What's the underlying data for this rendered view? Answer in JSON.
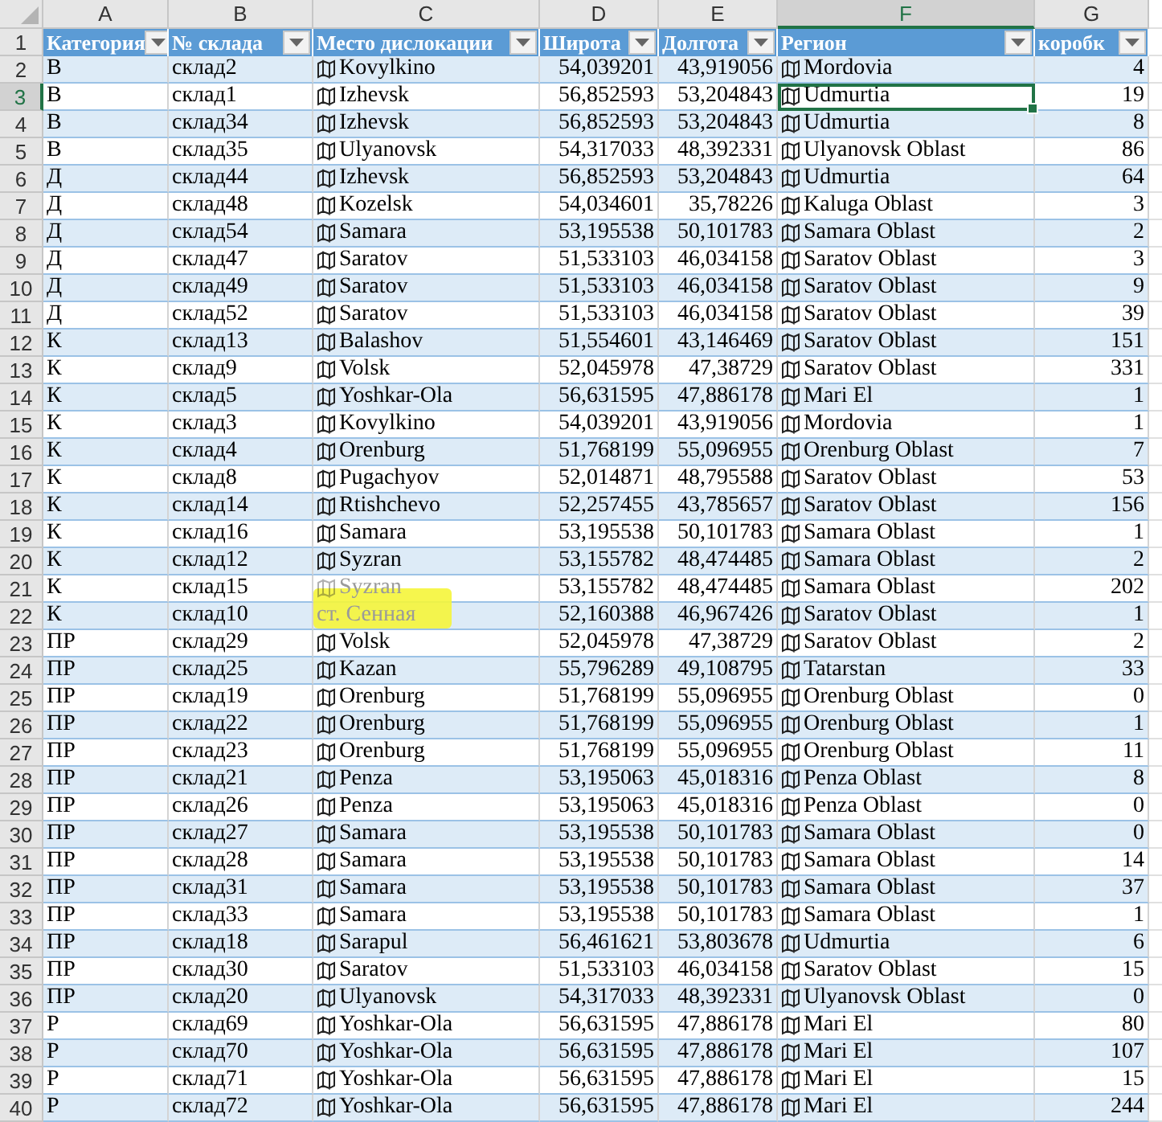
{
  "columns": [
    {
      "letter": "A",
      "selected": false
    },
    {
      "letter": "B",
      "selected": false
    },
    {
      "letter": "C",
      "selected": false
    },
    {
      "letter": "D",
      "selected": false
    },
    {
      "letter": "E",
      "selected": false
    },
    {
      "letter": "F",
      "selected": true
    },
    {
      "letter": "G",
      "selected": false
    }
  ],
  "header": {
    "num": "1",
    "cells": [
      "Категория",
      "№ склада",
      "Место дислокации",
      "Широта",
      "Долгота",
      "Регион",
      "коробк"
    ]
  },
  "rows": [
    {
      "num": "2",
      "selected": false,
      "category": "В",
      "warehouse": "склад2",
      "place": "Kovylkino",
      "place_icon": true,
      "place_faded": false,
      "highlighted": false,
      "lat": "54,039201",
      "lon": "43,919056",
      "region": "Mordovia",
      "boxes": "4"
    },
    {
      "num": "3",
      "selected": true,
      "category": "В",
      "warehouse": "склад1",
      "place": "Izhevsk",
      "place_icon": true,
      "place_faded": false,
      "highlighted": false,
      "lat": "56,852593",
      "lon": "53,204843",
      "region": "Udmurtia",
      "boxes": "19"
    },
    {
      "num": "4",
      "selected": false,
      "category": "В",
      "warehouse": "склад34",
      "place": "Izhevsk",
      "place_icon": true,
      "place_faded": false,
      "highlighted": false,
      "lat": "56,852593",
      "lon": "53,204843",
      "region": "Udmurtia",
      "boxes": "8"
    },
    {
      "num": "5",
      "selected": false,
      "category": "В",
      "warehouse": "склад35",
      "place": "Ulyanovsk",
      "place_icon": true,
      "place_faded": false,
      "highlighted": false,
      "lat": "54,317033",
      "lon": "48,392331",
      "region": "Ulyanovsk Oblast",
      "boxes": "86"
    },
    {
      "num": "6",
      "selected": false,
      "category": "Д",
      "warehouse": "склад44",
      "place": "Izhevsk",
      "place_icon": true,
      "place_faded": false,
      "highlighted": false,
      "lat": "56,852593",
      "lon": "53,204843",
      "region": "Udmurtia",
      "boxes": "64"
    },
    {
      "num": "7",
      "selected": false,
      "category": "Д",
      "warehouse": "склад48",
      "place": "Kozelsk",
      "place_icon": true,
      "place_faded": false,
      "highlighted": false,
      "lat": "54,034601",
      "lon": "35,78226",
      "region": "Kaluga Oblast",
      "boxes": "3"
    },
    {
      "num": "8",
      "selected": false,
      "category": "Д",
      "warehouse": "склад54",
      "place": "Samara",
      "place_icon": true,
      "place_faded": false,
      "highlighted": false,
      "lat": "53,195538",
      "lon": "50,101783",
      "region": "Samara Oblast",
      "boxes": "2"
    },
    {
      "num": "9",
      "selected": false,
      "category": "Д",
      "warehouse": "склад47",
      "place": "Saratov",
      "place_icon": true,
      "place_faded": false,
      "highlighted": false,
      "lat": "51,533103",
      "lon": "46,034158",
      "region": "Saratov Oblast",
      "boxes": "3"
    },
    {
      "num": "10",
      "selected": false,
      "category": "Д",
      "warehouse": "склад49",
      "place": "Saratov",
      "place_icon": true,
      "place_faded": false,
      "highlighted": false,
      "lat": "51,533103",
      "lon": "46,034158",
      "region": "Saratov Oblast",
      "boxes": "9"
    },
    {
      "num": "11",
      "selected": false,
      "category": "Д",
      "warehouse": "склад52",
      "place": "Saratov",
      "place_icon": true,
      "place_faded": false,
      "highlighted": false,
      "lat": "51,533103",
      "lon": "46,034158",
      "region": "Saratov Oblast",
      "boxes": "39"
    },
    {
      "num": "12",
      "selected": false,
      "category": "К",
      "warehouse": "склад13",
      "place": "Balashov",
      "place_icon": true,
      "place_faded": false,
      "highlighted": false,
      "lat": "51,554601",
      "lon": "43,146469",
      "region": "Saratov Oblast",
      "boxes": "151"
    },
    {
      "num": "13",
      "selected": false,
      "category": "К",
      "warehouse": "склад9",
      "place": "Volsk",
      "place_icon": true,
      "place_faded": false,
      "highlighted": false,
      "lat": "52,045978",
      "lon": "47,38729",
      "region": "Saratov Oblast",
      "boxes": "331"
    },
    {
      "num": "14",
      "selected": false,
      "category": "К",
      "warehouse": "склад5",
      "place": "Yoshkar-Ola",
      "place_icon": true,
      "place_faded": false,
      "highlighted": false,
      "lat": "56,631595",
      "lon": "47,886178",
      "region": "Mari El",
      "boxes": "1"
    },
    {
      "num": "15",
      "selected": false,
      "category": "К",
      "warehouse": "склад3",
      "place": "Kovylkino",
      "place_icon": true,
      "place_faded": false,
      "highlighted": false,
      "lat": "54,039201",
      "lon": "43,919056",
      "region": "Mordovia",
      "boxes": "1"
    },
    {
      "num": "16",
      "selected": false,
      "category": "К",
      "warehouse": "склад4",
      "place": "Orenburg",
      "place_icon": true,
      "place_faded": false,
      "highlighted": false,
      "lat": "51,768199",
      "lon": "55,096955",
      "region": "Orenburg Oblast",
      "boxes": "7"
    },
    {
      "num": "17",
      "selected": false,
      "category": "К",
      "warehouse": "склад8",
      "place": "Pugachyov",
      "place_icon": true,
      "place_faded": false,
      "highlighted": false,
      "lat": "52,014871",
      "lon": "48,795588",
      "region": "Saratov Oblast",
      "boxes": "53"
    },
    {
      "num": "18",
      "selected": false,
      "category": "К",
      "warehouse": "склад14",
      "place": "Rtishchevo",
      "place_icon": true,
      "place_faded": false,
      "highlighted": false,
      "lat": "52,257455",
      "lon": "43,785657",
      "region": "Saratov Oblast",
      "boxes": "156"
    },
    {
      "num": "19",
      "selected": false,
      "category": "К",
      "warehouse": "склад16",
      "place": "Samara",
      "place_icon": true,
      "place_faded": false,
      "highlighted": false,
      "lat": "53,195538",
      "lon": "50,101783",
      "region": "Samara Oblast",
      "boxes": "1"
    },
    {
      "num": "20",
      "selected": false,
      "category": "К",
      "warehouse": "склад12",
      "place": "Syzran",
      "place_icon": true,
      "place_faded": false,
      "highlighted": false,
      "lat": "53,155782",
      "lon": "48,474485",
      "region": "Samara Oblast",
      "boxes": "2"
    },
    {
      "num": "21",
      "selected": false,
      "category": "К",
      "warehouse": "склад15",
      "place": "Syzran",
      "place_icon": true,
      "place_faded": true,
      "highlighted": false,
      "lat": "53,155782",
      "lon": "48,474485",
      "region": "Samara Oblast",
      "boxes": "202"
    },
    {
      "num": "22",
      "selected": false,
      "category": "К",
      "warehouse": "склад10",
      "place": "ст. Сенная",
      "place_icon": false,
      "place_faded": true,
      "highlighted": true,
      "lat": "52,160388",
      "lon": "46,967426",
      "region": "Saratov Oblast",
      "boxes": "1"
    },
    {
      "num": "23",
      "selected": false,
      "category": "ПР",
      "warehouse": "склад29",
      "place": "Volsk",
      "place_icon": true,
      "place_faded": false,
      "highlighted": false,
      "lat": "52,045978",
      "lon": "47,38729",
      "region": "Saratov Oblast",
      "boxes": "2"
    },
    {
      "num": "24",
      "selected": false,
      "category": "ПР",
      "warehouse": "склад25",
      "place": "Kazan",
      "place_icon": true,
      "place_faded": false,
      "highlighted": false,
      "lat": "55,796289",
      "lon": "49,108795",
      "region": "Tatarstan",
      "boxes": "33"
    },
    {
      "num": "25",
      "selected": false,
      "category": "ПР",
      "warehouse": "склад19",
      "place": "Orenburg",
      "place_icon": true,
      "place_faded": false,
      "highlighted": false,
      "lat": "51,768199",
      "lon": "55,096955",
      "region": "Orenburg Oblast",
      "boxes": "0"
    },
    {
      "num": "26",
      "selected": false,
      "category": "ПР",
      "warehouse": "склад22",
      "place": "Orenburg",
      "place_icon": true,
      "place_faded": false,
      "highlighted": false,
      "lat": "51,768199",
      "lon": "55,096955",
      "region": "Orenburg Oblast",
      "boxes": "1"
    },
    {
      "num": "27",
      "selected": false,
      "category": "ПР",
      "warehouse": "склад23",
      "place": "Orenburg",
      "place_icon": true,
      "place_faded": false,
      "highlighted": false,
      "lat": "51,768199",
      "lon": "55,096955",
      "region": "Orenburg Oblast",
      "boxes": "11"
    },
    {
      "num": "28",
      "selected": false,
      "category": "ПР",
      "warehouse": "склад21",
      "place": "Penza",
      "place_icon": true,
      "place_faded": false,
      "highlighted": false,
      "lat": "53,195063",
      "lon": "45,018316",
      "region": "Penza Oblast",
      "boxes": "8"
    },
    {
      "num": "29",
      "selected": false,
      "category": "ПР",
      "warehouse": "склад26",
      "place": "Penza",
      "place_icon": true,
      "place_faded": false,
      "highlighted": false,
      "lat": "53,195063",
      "lon": "45,018316",
      "region": "Penza Oblast",
      "boxes": "0"
    },
    {
      "num": "30",
      "selected": false,
      "category": "ПР",
      "warehouse": "склад27",
      "place": "Samara",
      "place_icon": true,
      "place_faded": false,
      "highlighted": false,
      "lat": "53,195538",
      "lon": "50,101783",
      "region": "Samara Oblast",
      "boxes": "0"
    },
    {
      "num": "31",
      "selected": false,
      "category": "ПР",
      "warehouse": "склад28",
      "place": "Samara",
      "place_icon": true,
      "place_faded": false,
      "highlighted": false,
      "lat": "53,195538",
      "lon": "50,101783",
      "region": "Samara Oblast",
      "boxes": "14"
    },
    {
      "num": "32",
      "selected": false,
      "category": "ПР",
      "warehouse": "склад31",
      "place": "Samara",
      "place_icon": true,
      "place_faded": false,
      "highlighted": false,
      "lat": "53,195538",
      "lon": "50,101783",
      "region": "Samara Oblast",
      "boxes": "37"
    },
    {
      "num": "33",
      "selected": false,
      "category": "ПР",
      "warehouse": "склад33",
      "place": "Samara",
      "place_icon": true,
      "place_faded": false,
      "highlighted": false,
      "lat": "53,195538",
      "lon": "50,101783",
      "region": "Samara Oblast",
      "boxes": "1"
    },
    {
      "num": "34",
      "selected": false,
      "category": "ПР",
      "warehouse": "склад18",
      "place": "Sarapul",
      "place_icon": true,
      "place_faded": false,
      "highlighted": false,
      "lat": "56,461621",
      "lon": "53,803678",
      "region": "Udmurtia",
      "boxes": "6"
    },
    {
      "num": "35",
      "selected": false,
      "category": "ПР",
      "warehouse": "склад30",
      "place": "Saratov",
      "place_icon": true,
      "place_faded": false,
      "highlighted": false,
      "lat": "51,533103",
      "lon": "46,034158",
      "region": "Saratov Oblast",
      "boxes": "15"
    },
    {
      "num": "36",
      "selected": false,
      "category": "ПР",
      "warehouse": "склад20",
      "place": "Ulyanovsk",
      "place_icon": true,
      "place_faded": false,
      "highlighted": false,
      "lat": "54,317033",
      "lon": "48,392331",
      "region": "Ulyanovsk Oblast",
      "boxes": "0"
    },
    {
      "num": "37",
      "selected": false,
      "category": "Р",
      "warehouse": "склад69",
      "place": "Yoshkar-Ola",
      "place_icon": true,
      "place_faded": false,
      "highlighted": false,
      "lat": "56,631595",
      "lon": "47,886178",
      "region": "Mari El",
      "boxes": "80"
    },
    {
      "num": "38",
      "selected": false,
      "category": "Р",
      "warehouse": "склад70",
      "place": "Yoshkar-Ola",
      "place_icon": true,
      "place_faded": false,
      "highlighted": false,
      "lat": "56,631595",
      "lon": "47,886178",
      "region": "Mari El",
      "boxes": "107"
    },
    {
      "num": "39",
      "selected": false,
      "category": "Р",
      "warehouse": "склад71",
      "place": "Yoshkar-Ola",
      "place_icon": true,
      "place_faded": false,
      "highlighted": false,
      "lat": "56,631595",
      "lon": "47,886178",
      "region": "Mari El",
      "boxes": "15"
    },
    {
      "num": "40",
      "selected": false,
      "category": "Р",
      "warehouse": "склад72",
      "place": "Yoshkar-Ola",
      "place_icon": true,
      "place_faded": false,
      "highlighted": false,
      "lat": "56,631595",
      "lon": "47,886178",
      "region": "Mari El",
      "boxes": "244"
    }
  ]
}
